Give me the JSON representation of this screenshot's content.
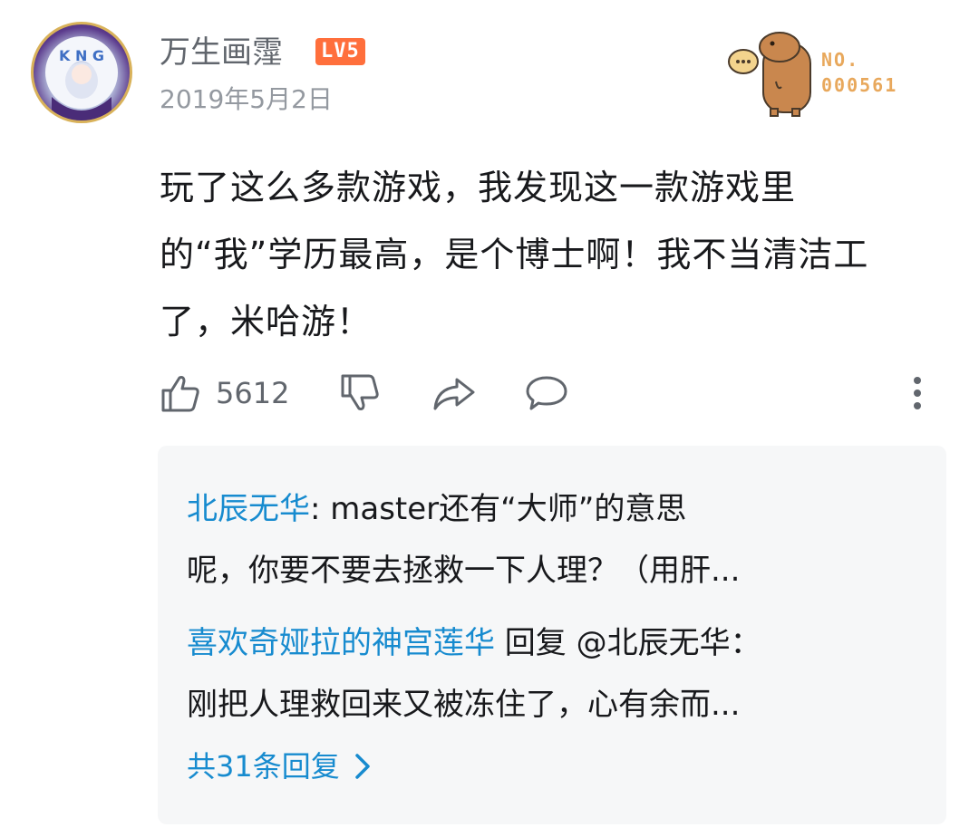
{
  "comment": {
    "username": "万生画霪",
    "level_badge": "LV5",
    "date": "2019年5月2日",
    "fan_label": "NO.",
    "fan_number": "000561",
    "text": "玩了这么多款游戏，我发现这一款游戏里的“我”学历最高，是个博士啊！我不当清洁工了，米哈游！",
    "like_count": "5612",
    "icons": [
      "like-icon",
      "dislike-icon",
      "share-icon",
      "reply-icon",
      "more-icon"
    ]
  },
  "replies": [
    {
      "author": "北辰无华",
      "text_line1": ": master还有“大师”的意思",
      "text_line2": "呢，你要不要去拯救一下人理？（用肝..."
    },
    {
      "author": "喜欢奇娅拉的神宫莲华",
      "text_line1": " 回复 @北辰无华：",
      "text_line2": "刚把人理救回来又被冻住了，心有余而..."
    }
  ],
  "more_replies_label": "共31条回复",
  "colors": {
    "link": "#178bcf",
    "level_badge": "#ff6f3c",
    "fan_number": "#e8a85c",
    "reply_bg": "#f6f7f8"
  }
}
